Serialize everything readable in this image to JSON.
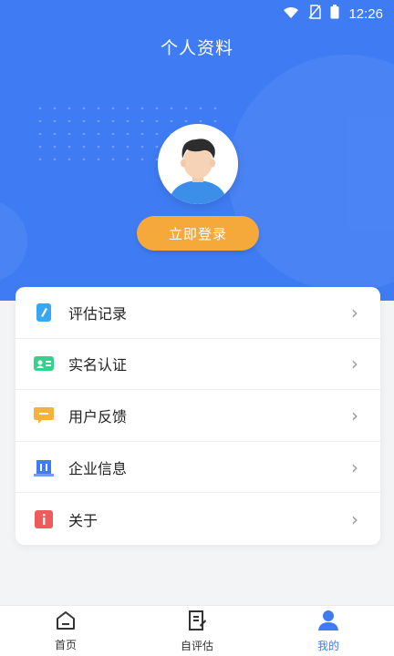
{
  "status_bar": {
    "time": "12:26",
    "icons": [
      "wifi-icon",
      "no-signal-icon",
      "battery-icon"
    ]
  },
  "header": {
    "title": "个人资料"
  },
  "profile": {
    "avatar": "avatar-icon",
    "login_label": "立即登录"
  },
  "menu": {
    "items": [
      {
        "label": "评估记录",
        "icon": "record-icon",
        "color": "#38a7f0"
      },
      {
        "label": "实名认证",
        "icon": "id-card-icon",
        "color": "#3bcf8e"
      },
      {
        "label": "用户反馈",
        "icon": "feedback-icon",
        "color": "#f6b13a"
      },
      {
        "label": "企业信息",
        "icon": "building-icon",
        "color": "#3f7cf4"
      },
      {
        "label": "关于",
        "icon": "info-icon",
        "color": "#ef5b5b"
      }
    ]
  },
  "tabbar": {
    "items": [
      {
        "label": "首页",
        "icon": "home-icon",
        "active": false
      },
      {
        "label": "自评估",
        "icon": "document-icon",
        "active": false
      },
      {
        "label": "我的",
        "icon": "user-icon",
        "active": true
      }
    ]
  },
  "colors": {
    "primary": "#3f7cf4",
    "login_button": "#f6a93b",
    "background": "#f3f4f6"
  }
}
